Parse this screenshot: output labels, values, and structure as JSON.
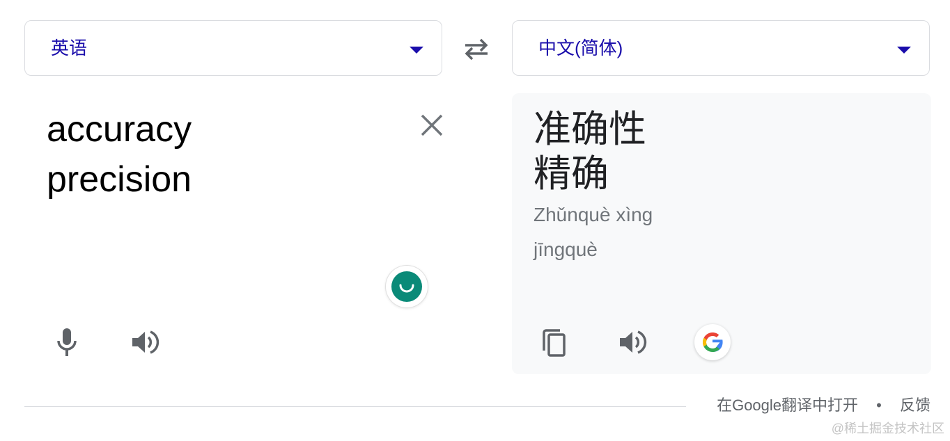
{
  "source": {
    "language": "英语",
    "lines": [
      "accuracy",
      "precision"
    ]
  },
  "target": {
    "language": "中文(简体)",
    "lines": [
      "准确性",
      "精确"
    ],
    "pinyin": [
      "Zhǔnquè xìng",
      "jīngquè"
    ]
  },
  "footer": {
    "open_in_google": "在Google翻译中打开",
    "separator": "•",
    "feedback": "反馈"
  },
  "watermark": "@稀土掘金技术社区",
  "colors": {
    "link": "#1a0dab",
    "panel_bg": "#f8f9fa",
    "icon": "#5f6368",
    "grammarly": "#0a8a78"
  },
  "icons": [
    "swap-icon",
    "close-icon",
    "mic-icon",
    "speaker-icon",
    "copy-icon",
    "google-logo-icon",
    "grammarly-icon",
    "chevron-down-icon"
  ]
}
